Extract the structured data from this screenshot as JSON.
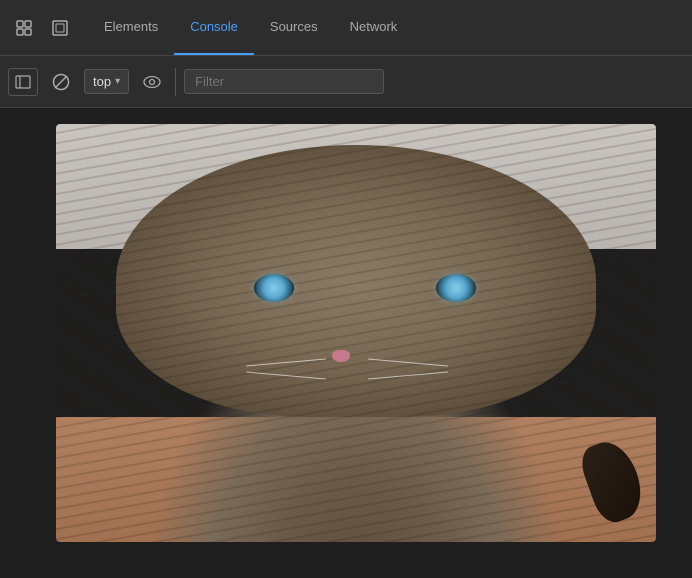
{
  "toolbar": {
    "tabs": [
      {
        "id": "elements",
        "label": "Elements",
        "active": false
      },
      {
        "id": "console",
        "label": "Console",
        "active": true
      },
      {
        "id": "sources",
        "label": "Sources",
        "active": false
      },
      {
        "id": "network",
        "label": "Network",
        "active": false
      }
    ]
  },
  "secondary_toolbar": {
    "context": "top",
    "filter_placeholder": "Filter"
  },
  "icons": {
    "cursor_select": "⊹",
    "inspect_element": "□",
    "sidebar_toggle": "◫",
    "clear": "⊘",
    "eye": "👁",
    "chevron_down": "▾"
  },
  "colors": {
    "background": "#1e1e1e",
    "toolbar_bg": "#2d2d2d",
    "active_tab": "#4a9eff",
    "inactive_text": "#aaa",
    "border": "#444"
  }
}
